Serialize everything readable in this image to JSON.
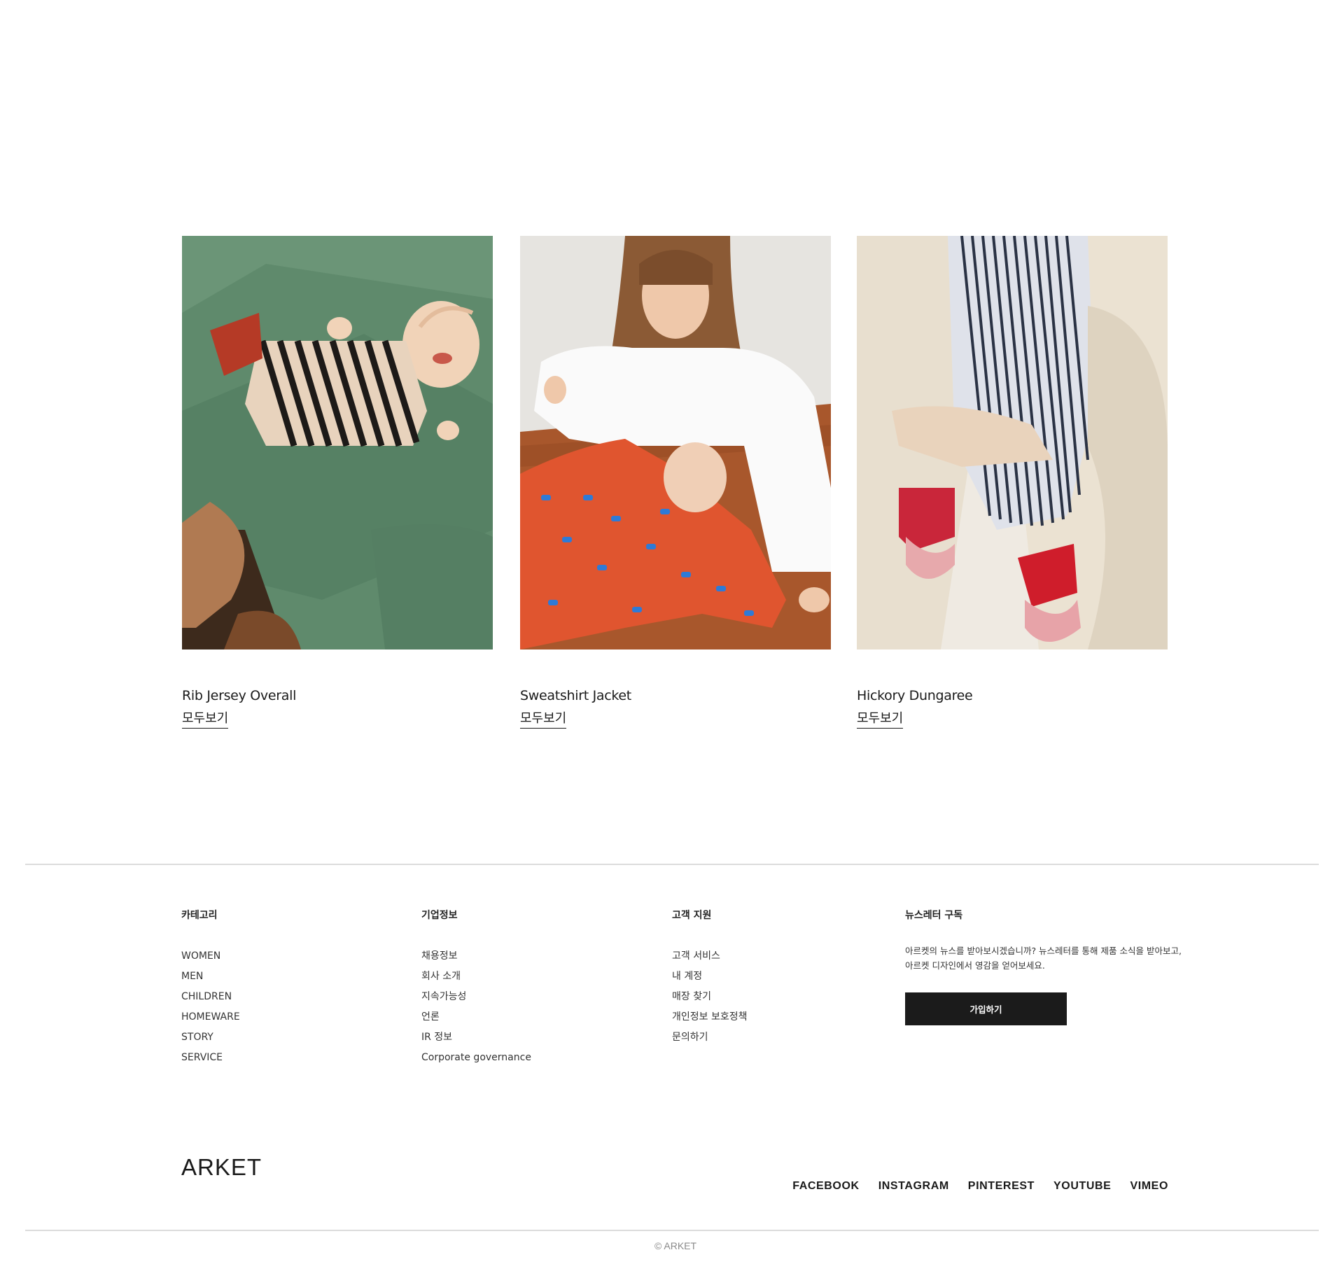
{
  "products": [
    {
      "name": "Rib Jersey Overall",
      "link_label": "모두보기"
    },
    {
      "name": "Sweatshirt Jacket",
      "link_label": "모두보기"
    },
    {
      "name": "Hickory Dungaree",
      "link_label": "모두보기"
    }
  ],
  "footer": {
    "category": {
      "title": "카테고리",
      "items": [
        "WOMEN",
        "MEN",
        "CHILDREN",
        "HOMEWARE",
        "STORY",
        "SERVICE"
      ]
    },
    "corporate": {
      "title": "기업정보",
      "items": [
        "채용정보",
        "회사 소개",
        "지속가능성",
        "언론",
        "IR 정보",
        "Corporate governance"
      ]
    },
    "customer_service": {
      "title": "고객 지원",
      "items": [
        "고객 서비스",
        "내 계정",
        "매장 찾기",
        "개인정보 보호정책",
        "문의하기"
      ]
    },
    "newsletter": {
      "title": "뉴스레터 구독",
      "text_line1": "아르켓의 뉴스를 받아보시겠습니까? 뉴스레터를 통해 제품 소식을 받아보고,",
      "text_line2": "아르켓 디자인에서 영감을 얻어보세요.",
      "button_label": "가입하기"
    },
    "logo": "ARKET",
    "social": [
      "FACEBOOK",
      "INSTAGRAM",
      "PINTEREST",
      "YOUTUBE",
      "VIMEO"
    ],
    "copyright": "© ARKET"
  },
  "colors": {
    "background": "#ffffff",
    "text": "#1a1a1a",
    "button": "#1b1b1b",
    "divider": "#dcdcdc",
    "copyright": "#8a8a8a"
  }
}
